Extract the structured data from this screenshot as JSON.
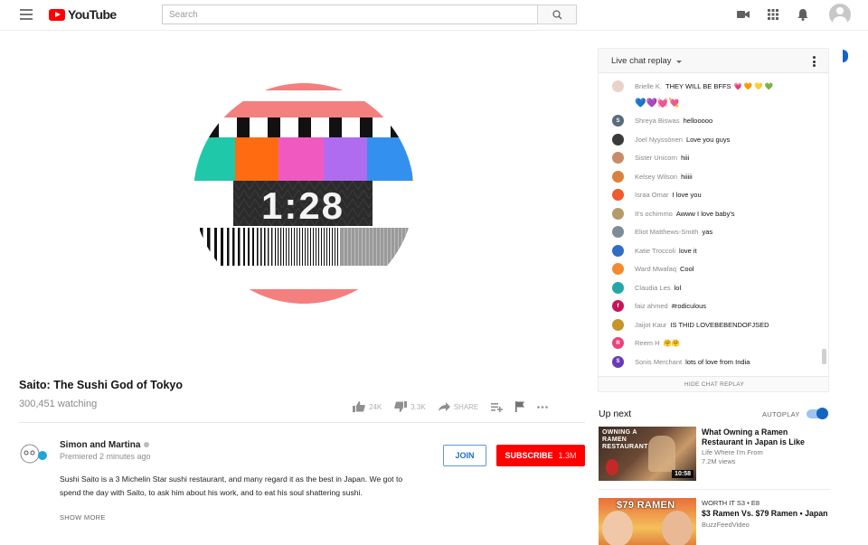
{
  "header": {
    "logo_text": "YouTube",
    "search_placeholder": "Search"
  },
  "video": {
    "countdown": "1:28",
    "title": "Saito: The Sushi God of Tokyo",
    "watching": "300,451 watching",
    "likes": "24K",
    "dislikes": "3.3K",
    "share_label": "SHARE"
  },
  "channel": {
    "name": "Simon and Martina",
    "premiered": "Premiered 2 minutes ago",
    "join_label": "JOIN",
    "subscribe_label": "SUBSCRIBE",
    "subscriber_count": "1.3M",
    "description": "Sushi Saito is a 3 Michelin Star sushi restaurant, and many regard it as the best in Japan.  We got to spend the day with Saito, to ask him about his work, and to eat his soul shattering sushi.",
    "show_more": "SHOW MORE"
  },
  "chat": {
    "header": "Live chat replay",
    "hide_label": "HIDE CHAT REPLAY",
    "first": {
      "author": "Brielle K.",
      "text": "THEY WILL BE BFFS",
      "emoji_inline": "💗🧡💛💚",
      "emoji_row": "💙💜💓💘"
    },
    "messages": [
      {
        "author": "Shreya Biswas",
        "text": "hellooooo",
        "color": "#5a6b7c",
        "initial": "S"
      },
      {
        "author": "Joel Nyyssönen",
        "text": "Love you guys",
        "color": "#3a3a3a",
        "initial": ""
      },
      {
        "author": "Sister Unicorn",
        "text": "hiii",
        "color": "#c98a6a",
        "initial": ""
      },
      {
        "author": "Kelsey Wilson",
        "text": "hiiiii",
        "color": "#d9823b",
        "initial": ""
      },
      {
        "author": "Israa Omar",
        "text": "I love you",
        "color": "#ef5a2f",
        "initial": ""
      },
      {
        "author": "It's ochimmo",
        "text": "Awww I love baby's",
        "color": "#b49a6a",
        "initial": ""
      },
      {
        "author": "Eliot Matthews-Smith",
        "text": "yas",
        "color": "#7d8c99",
        "initial": ""
      },
      {
        "author": "Katie Troccoli",
        "text": "love it",
        "color": "#2f6fc2",
        "initial": ""
      },
      {
        "author": "Ward Mwafaq",
        "text": "Cool",
        "color": "#f28b30",
        "initial": ""
      },
      {
        "author": "Claudia Les",
        "text": "lol",
        "color": "#26a6a6",
        "initial": ""
      },
      {
        "author": "faiz ahmed",
        "text": "#rodiculous",
        "color": "#c2185b",
        "initial": "f"
      },
      {
        "author": "Jaijot Kaur",
        "text": "IS THID LOVEBEBENDOFJSED",
        "color": "#c4952a",
        "initial": ""
      },
      {
        "author": "Reem H",
        "text": "🤗🤗",
        "color": "#ec407a",
        "initial": "R"
      },
      {
        "author": "Sonis Merchant",
        "text": "lots of love from India",
        "color": "#673ab7",
        "initial": "S"
      }
    ]
  },
  "upnext": {
    "label": "Up next",
    "autoplay_label": "AUTOPLAY",
    "autoplay_on": true,
    "items": [
      {
        "title": "What Owning a Ramen Restaurant in Japan is Like",
        "channel": "Life Where I'm From",
        "views": "7.2M views",
        "duration": "10:58",
        "thumb_text": "OWNING A RAMEN RESTAURANT"
      },
      {
        "title": "$3 Ramen Vs. $79 Ramen • Japan",
        "kicker": "WORTH IT  S3 • E8",
        "channel": "BuzzFeedVideo",
        "views": "",
        "thumb_text": "$79 RAMEN"
      }
    ]
  }
}
